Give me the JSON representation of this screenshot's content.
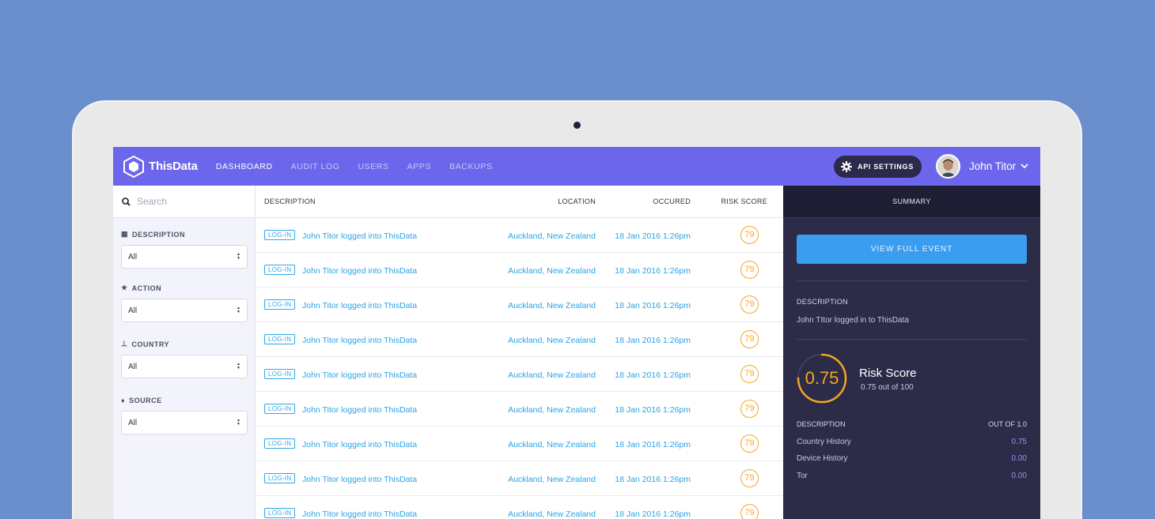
{
  "app": {
    "name": "ThisData",
    "nav": [
      {
        "label": "DASHBOARD",
        "active": true
      },
      {
        "label": "AUDIT LOG",
        "active": false
      },
      {
        "label": "USERS",
        "active": false
      },
      {
        "label": "APPS",
        "active": false
      },
      {
        "label": "BACKUPS",
        "active": false
      }
    ],
    "api_settings_label": "API SETTINGS",
    "user_name": "John Titor"
  },
  "sidebar": {
    "search_placeholder": "Search",
    "filters": [
      {
        "label": "DESCRIPTION",
        "value": "All",
        "icon": "calendar-icon"
      },
      {
        "label": "ACTION",
        "value": "All",
        "icon": "star-icon"
      },
      {
        "label": "COUNTRY",
        "value": "All",
        "icon": "pin-icon"
      },
      {
        "label": "SOURCE",
        "value": "All",
        "icon": "drop-icon"
      }
    ]
  },
  "table": {
    "headers": {
      "description": "DESCRIPTION",
      "location": "LOCATION",
      "occured": "OCCURED",
      "risk": "RISK SCORE"
    },
    "rows": [
      {
        "tag": "LOG-IN",
        "description": "John Titor logged into ThisData",
        "location": "Auckland, New Zealand",
        "occured": "18 Jan 2016 1:26pm",
        "risk": "79"
      },
      {
        "tag": "LOG-IN",
        "description": "John Titor logged into ThisData",
        "location": "Auckland, New Zealand",
        "occured": "18 Jan 2016 1:26pm",
        "risk": "79"
      },
      {
        "tag": "LOG-IN",
        "description": "John Titor logged into ThisData",
        "location": "Auckland, New Zealand",
        "occured": "18 Jan 2016 1:26pm",
        "risk": "79"
      },
      {
        "tag": "LOG-IN",
        "description": "John Titor logged into ThisData",
        "location": "Auckland, New Zealand",
        "occured": "18 Jan 2016 1:26pm",
        "risk": "79"
      },
      {
        "tag": "LOG-IN",
        "description": "John Titor logged into ThisData",
        "location": "Auckland, New Zealand",
        "occured": "18 Jan 2016 1:26pm",
        "risk": "79"
      },
      {
        "tag": "LOG-IN",
        "description": "John Titor logged into ThisData",
        "location": "Auckland, New Zealand",
        "occured": "18 Jan 2016 1:26pm",
        "risk": "79"
      },
      {
        "tag": "LOG-IN",
        "description": "John Titor logged into ThisData",
        "location": "Auckland, New Zealand",
        "occured": "18 Jan 2016 1:26pm",
        "risk": "79"
      },
      {
        "tag": "LOG-IN",
        "description": "John Titor logged into ThisData",
        "location": "Auckland, New Zealand",
        "occured": "18 Jan 2016 1:26pm",
        "risk": "79"
      },
      {
        "tag": "LOG-IN",
        "description": "John Titor logged into ThisData",
        "location": "Auckland, New Zealand",
        "occured": "18 Jan 2016 1:26pm",
        "risk": "79"
      }
    ]
  },
  "summary": {
    "title": "SUMMARY",
    "view_button": "VIEW FULL EVENT",
    "description_label": "DESCRIPTION",
    "description_text": "John TItor logged in to ThisData",
    "risk_value": "0.75",
    "risk_fraction": 0.75,
    "risk_title": "Risk Score",
    "risk_sub": "0.75 out of 100",
    "breakdown_label": "DESCRIPTION",
    "breakdown_out_of": "OUT OF 1.0",
    "breakdown": [
      {
        "name": "Country History",
        "value": "0.75"
      },
      {
        "name": "Device History",
        "value": "0.00"
      },
      {
        "name": "Tor",
        "value": "0.00"
      }
    ]
  },
  "colors": {
    "nav": "#6c66ec",
    "accent": "#2aa3e6",
    "risk": "#f5a623",
    "panel": "#2c2b48"
  }
}
